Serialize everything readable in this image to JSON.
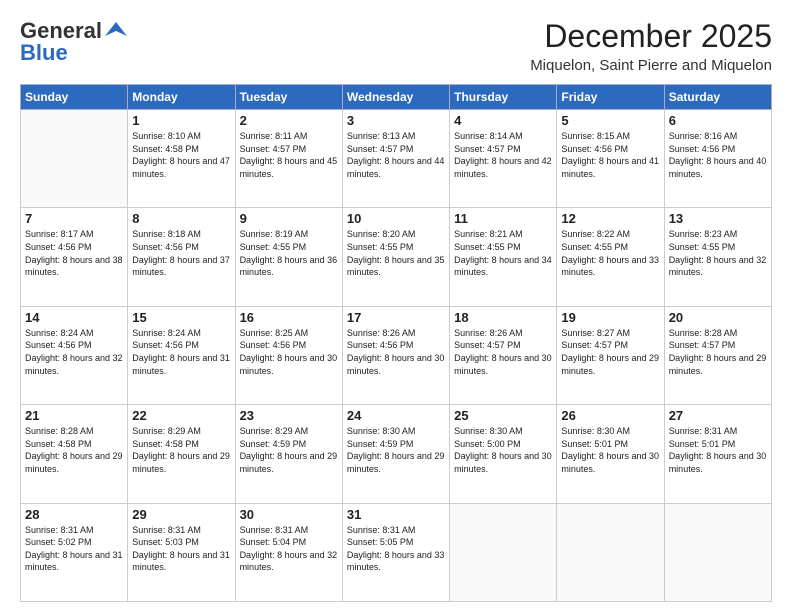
{
  "logo": {
    "line1": "General",
    "line2": "Blue"
  },
  "header": {
    "month": "December 2025",
    "location": "Miquelon, Saint Pierre and Miquelon"
  },
  "weekdays": [
    "Sunday",
    "Monday",
    "Tuesday",
    "Wednesday",
    "Thursday",
    "Friday",
    "Saturday"
  ],
  "weeks": [
    [
      {
        "day": "",
        "sunrise": "",
        "sunset": "",
        "daylight": ""
      },
      {
        "day": "1",
        "sunrise": "Sunrise: 8:10 AM",
        "sunset": "Sunset: 4:58 PM",
        "daylight": "Daylight: 8 hours and 47 minutes."
      },
      {
        "day": "2",
        "sunrise": "Sunrise: 8:11 AM",
        "sunset": "Sunset: 4:57 PM",
        "daylight": "Daylight: 8 hours and 45 minutes."
      },
      {
        "day": "3",
        "sunrise": "Sunrise: 8:13 AM",
        "sunset": "Sunset: 4:57 PM",
        "daylight": "Daylight: 8 hours and 44 minutes."
      },
      {
        "day": "4",
        "sunrise": "Sunrise: 8:14 AM",
        "sunset": "Sunset: 4:57 PM",
        "daylight": "Daylight: 8 hours and 42 minutes."
      },
      {
        "day": "5",
        "sunrise": "Sunrise: 8:15 AM",
        "sunset": "Sunset: 4:56 PM",
        "daylight": "Daylight: 8 hours and 41 minutes."
      },
      {
        "day": "6",
        "sunrise": "Sunrise: 8:16 AM",
        "sunset": "Sunset: 4:56 PM",
        "daylight": "Daylight: 8 hours and 40 minutes."
      }
    ],
    [
      {
        "day": "7",
        "sunrise": "Sunrise: 8:17 AM",
        "sunset": "Sunset: 4:56 PM",
        "daylight": "Daylight: 8 hours and 38 minutes."
      },
      {
        "day": "8",
        "sunrise": "Sunrise: 8:18 AM",
        "sunset": "Sunset: 4:56 PM",
        "daylight": "Daylight: 8 hours and 37 minutes."
      },
      {
        "day": "9",
        "sunrise": "Sunrise: 8:19 AM",
        "sunset": "Sunset: 4:55 PM",
        "daylight": "Daylight: 8 hours and 36 minutes."
      },
      {
        "day": "10",
        "sunrise": "Sunrise: 8:20 AM",
        "sunset": "Sunset: 4:55 PM",
        "daylight": "Daylight: 8 hours and 35 minutes."
      },
      {
        "day": "11",
        "sunrise": "Sunrise: 8:21 AM",
        "sunset": "Sunset: 4:55 PM",
        "daylight": "Daylight: 8 hours and 34 minutes."
      },
      {
        "day": "12",
        "sunrise": "Sunrise: 8:22 AM",
        "sunset": "Sunset: 4:55 PM",
        "daylight": "Daylight: 8 hours and 33 minutes."
      },
      {
        "day": "13",
        "sunrise": "Sunrise: 8:23 AM",
        "sunset": "Sunset: 4:55 PM",
        "daylight": "Daylight: 8 hours and 32 minutes."
      }
    ],
    [
      {
        "day": "14",
        "sunrise": "Sunrise: 8:24 AM",
        "sunset": "Sunset: 4:56 PM",
        "daylight": "Daylight: 8 hours and 32 minutes."
      },
      {
        "day": "15",
        "sunrise": "Sunrise: 8:24 AM",
        "sunset": "Sunset: 4:56 PM",
        "daylight": "Daylight: 8 hours and 31 minutes."
      },
      {
        "day": "16",
        "sunrise": "Sunrise: 8:25 AM",
        "sunset": "Sunset: 4:56 PM",
        "daylight": "Daylight: 8 hours and 30 minutes."
      },
      {
        "day": "17",
        "sunrise": "Sunrise: 8:26 AM",
        "sunset": "Sunset: 4:56 PM",
        "daylight": "Daylight: 8 hours and 30 minutes."
      },
      {
        "day": "18",
        "sunrise": "Sunrise: 8:26 AM",
        "sunset": "Sunset: 4:57 PM",
        "daylight": "Daylight: 8 hours and 30 minutes."
      },
      {
        "day": "19",
        "sunrise": "Sunrise: 8:27 AM",
        "sunset": "Sunset: 4:57 PM",
        "daylight": "Daylight: 8 hours and 29 minutes."
      },
      {
        "day": "20",
        "sunrise": "Sunrise: 8:28 AM",
        "sunset": "Sunset: 4:57 PM",
        "daylight": "Daylight: 8 hours and 29 minutes."
      }
    ],
    [
      {
        "day": "21",
        "sunrise": "Sunrise: 8:28 AM",
        "sunset": "Sunset: 4:58 PM",
        "daylight": "Daylight: 8 hours and 29 minutes."
      },
      {
        "day": "22",
        "sunrise": "Sunrise: 8:29 AM",
        "sunset": "Sunset: 4:58 PM",
        "daylight": "Daylight: 8 hours and 29 minutes."
      },
      {
        "day": "23",
        "sunrise": "Sunrise: 8:29 AM",
        "sunset": "Sunset: 4:59 PM",
        "daylight": "Daylight: 8 hours and 29 minutes."
      },
      {
        "day": "24",
        "sunrise": "Sunrise: 8:30 AM",
        "sunset": "Sunset: 4:59 PM",
        "daylight": "Daylight: 8 hours and 29 minutes."
      },
      {
        "day": "25",
        "sunrise": "Sunrise: 8:30 AM",
        "sunset": "Sunset: 5:00 PM",
        "daylight": "Daylight: 8 hours and 30 minutes."
      },
      {
        "day": "26",
        "sunrise": "Sunrise: 8:30 AM",
        "sunset": "Sunset: 5:01 PM",
        "daylight": "Daylight: 8 hours and 30 minutes."
      },
      {
        "day": "27",
        "sunrise": "Sunrise: 8:31 AM",
        "sunset": "Sunset: 5:01 PM",
        "daylight": "Daylight: 8 hours and 30 minutes."
      }
    ],
    [
      {
        "day": "28",
        "sunrise": "Sunrise: 8:31 AM",
        "sunset": "Sunset: 5:02 PM",
        "daylight": "Daylight: 8 hours and 31 minutes."
      },
      {
        "day": "29",
        "sunrise": "Sunrise: 8:31 AM",
        "sunset": "Sunset: 5:03 PM",
        "daylight": "Daylight: 8 hours and 31 minutes."
      },
      {
        "day": "30",
        "sunrise": "Sunrise: 8:31 AM",
        "sunset": "Sunset: 5:04 PM",
        "daylight": "Daylight: 8 hours and 32 minutes."
      },
      {
        "day": "31",
        "sunrise": "Sunrise: 8:31 AM",
        "sunset": "Sunset: 5:05 PM",
        "daylight": "Daylight: 8 hours and 33 minutes."
      },
      {
        "day": "",
        "sunrise": "",
        "sunset": "",
        "daylight": ""
      },
      {
        "day": "",
        "sunrise": "",
        "sunset": "",
        "daylight": ""
      },
      {
        "day": "",
        "sunrise": "",
        "sunset": "",
        "daylight": ""
      }
    ]
  ]
}
